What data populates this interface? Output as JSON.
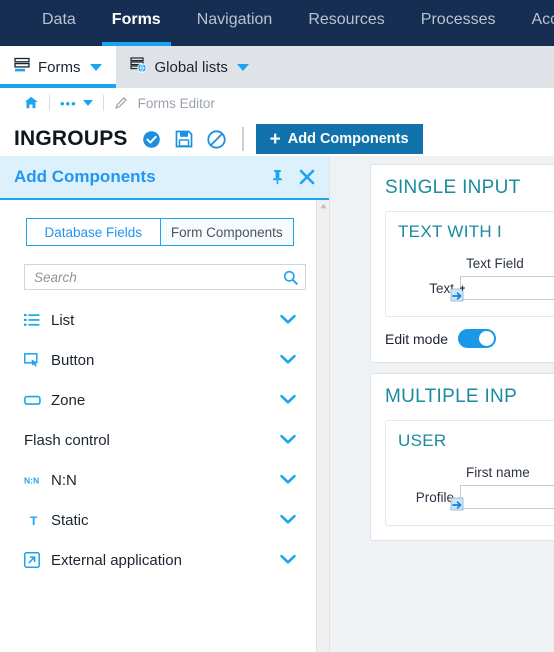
{
  "topnav": {
    "tabs": [
      {
        "label": "Data",
        "active": false
      },
      {
        "label": "Forms",
        "active": true
      },
      {
        "label": "Navigation",
        "active": false
      },
      {
        "label": "Resources",
        "active": false
      },
      {
        "label": "Processes",
        "active": false
      },
      {
        "label": "Acc",
        "active": false
      }
    ]
  },
  "subbar": {
    "items": [
      {
        "label": "Forms",
        "icon": "forms-icon",
        "active": true
      },
      {
        "label": "Global lists",
        "icon": "global-lists-icon",
        "active": false
      }
    ]
  },
  "breadcrumb": {
    "home_icon": "home-icon",
    "ellipsis": "•••",
    "edit_icon": "pencil-icon",
    "label": "Forms Editor"
  },
  "title_row": {
    "title": "INGROUPS",
    "icons": [
      {
        "name": "check-circle-icon"
      },
      {
        "name": "save-icon"
      },
      {
        "name": "cancel-icon"
      }
    ],
    "add_components_label": "Add Components",
    "add_components_plus": "+"
  },
  "panel": {
    "title": "Add Components",
    "pin_icon": "pin-icon",
    "close_icon": "close-icon",
    "tabs": [
      {
        "label": "Database Fields",
        "active": true
      },
      {
        "label": "Form Components",
        "active": false
      }
    ],
    "search": {
      "value": "",
      "placeholder": "Search",
      "icon": "search-icon"
    },
    "categories": [
      {
        "label": "List",
        "icon": "list-icon",
        "chevron": "❯"
      },
      {
        "label": "Button",
        "icon": "button-icon",
        "chevron": "❯"
      },
      {
        "label": "Zone",
        "icon": "zone-icon",
        "chevron": "❯"
      },
      {
        "label": "Flash control",
        "icon": "",
        "chevron": "❯"
      },
      {
        "label": "N:N",
        "icon": "nn-icon",
        "chevron": "❯"
      },
      {
        "label": "Static",
        "icon": "text-static-icon",
        "chevron": "❯"
      },
      {
        "label": "External application",
        "icon": "external-application-icon",
        "chevron": "❯"
      }
    ]
  },
  "canvas": {
    "blocks": [
      {
        "title": "SINGLE INPUT",
        "inner_title": "TEXT WITH I",
        "field_header": "Text Field",
        "field_label": "Text",
        "field_value": "",
        "edit_mode_label": "Edit mode",
        "edit_mode_on": true
      },
      {
        "title": "MULTIPLE INP",
        "inner_title": "USER",
        "field_header": "First name",
        "field_label": "Profile",
        "field_value": ""
      }
    ]
  },
  "colors": {
    "nav_bg": "#152e52",
    "accent_blue": "#1ca4f0",
    "button_blue": "#1273ac",
    "panel_header_bg": "#ddf1fc",
    "teal_title": "#1a8ba0",
    "canvas_bg": "#eef2f5"
  }
}
